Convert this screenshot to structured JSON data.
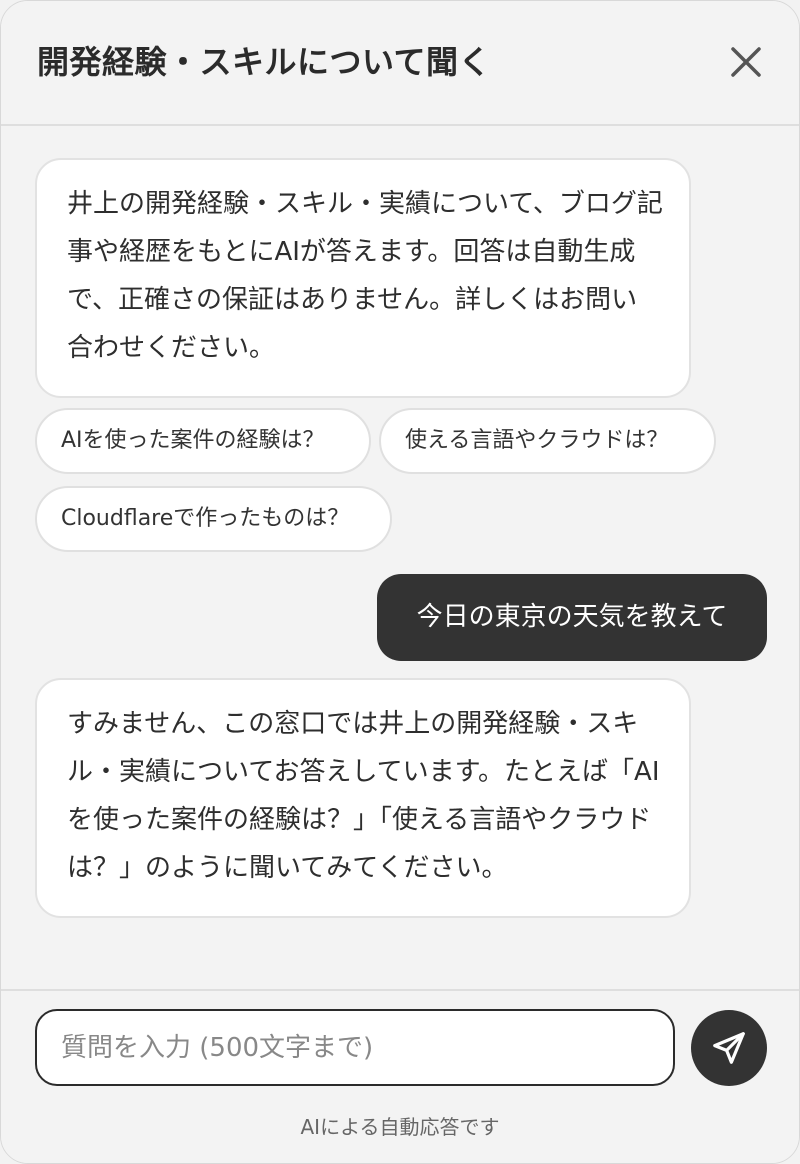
{
  "header": {
    "title": "開発経験・スキルについて聞く",
    "close_icon": "close-icon"
  },
  "messages": {
    "intro": "井上の開発経験・スキル・実績について、ブログ記事や経歴をもとにAIが答えます。回答は自動生成で、正確さの保証はありません。詳しくはお問い合わせください。",
    "suggestions": [
      "AIを使った案件の経験は？",
      "使える言語やクラウドは？",
      "Cloudflareで作ったものは？"
    ],
    "user_message": "今日の東京の天気を教えて",
    "ai_reply": "すみません、この窓口では井上の開発経験・スキル・実績についてお答えしています。たとえば「AIを使った案件の経験は？」「使える言語やクラウドは？」のように聞いてみてください。"
  },
  "footer": {
    "input_placeholder": "質問を入力 (500文字まで)",
    "send_icon": "send-icon",
    "disclaimer": "AIによる自動応答です"
  },
  "colors": {
    "background": "#f3f3f3",
    "bubble_ai": "#ffffff",
    "bubble_user": "#333333",
    "send_button": "#333333"
  }
}
